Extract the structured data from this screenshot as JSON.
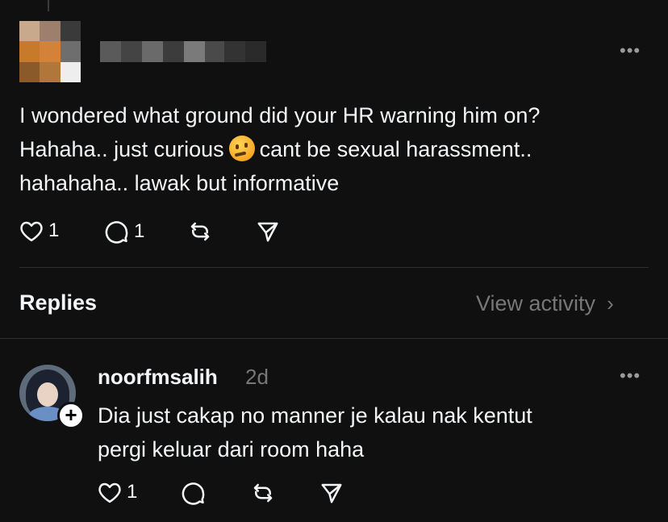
{
  "post": {
    "text_line1": "I wondered what ground did your HR warning him on?",
    "text_line2a": "Hahaha.. just curious",
    "emoji": "thinking-face",
    "text_line2b": "cant be sexual harassment..",
    "text_line3": "hahahaha.. lawak but informative",
    "likes": "1",
    "comments": "1",
    "more_label": "•••"
  },
  "replies_header": {
    "title": "Replies",
    "view_activity": "View activity",
    "chevron": "›"
  },
  "reply": {
    "username": "noorfmsalih",
    "time": "2d",
    "text": "Dia just cakap no manner je kalau nak kentut\npergi keluar dari room haha",
    "likes": "1",
    "follow_glyph": "+",
    "more_label": "•••"
  },
  "colors": {
    "background": "#101010",
    "text": "#f3f5f7",
    "muted": "#777777",
    "divider": "#2d2d2d"
  }
}
